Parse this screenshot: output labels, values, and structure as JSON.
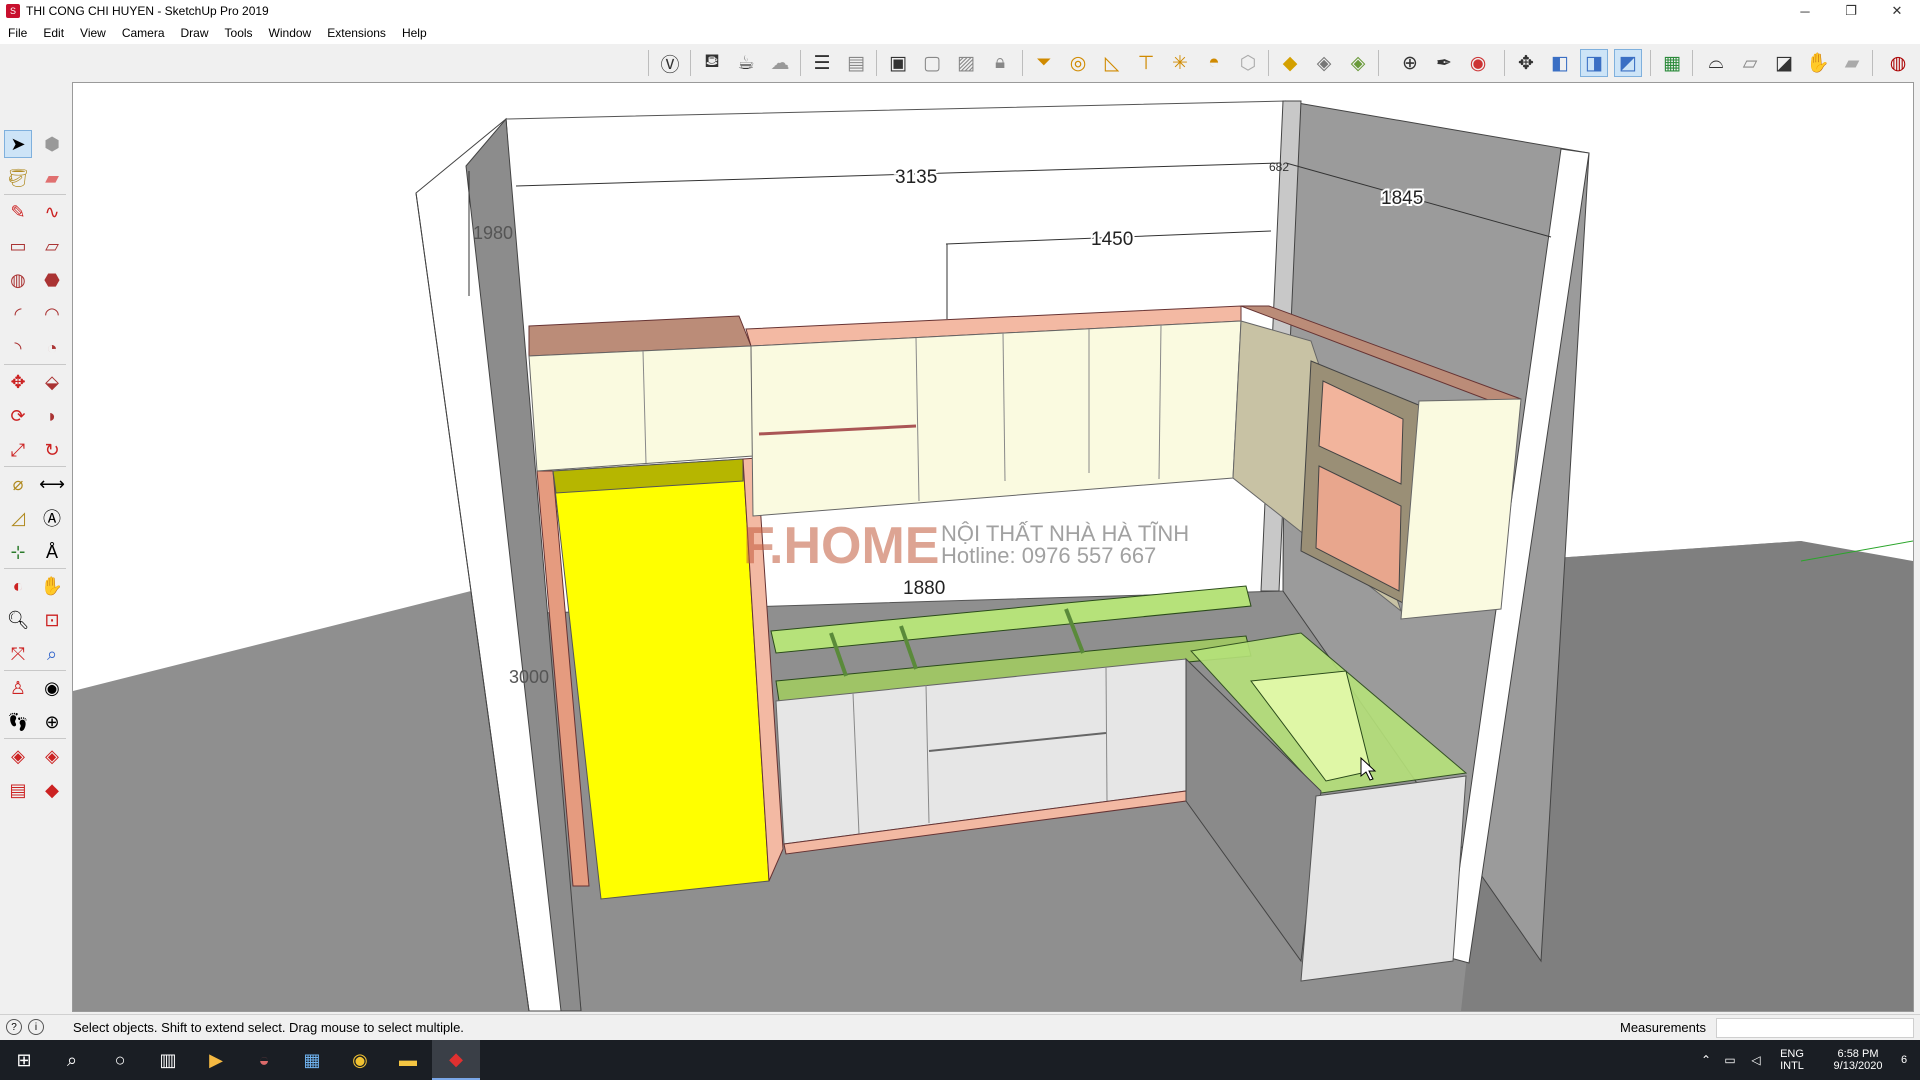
{
  "window": {
    "title": "THI CONG CHI HUYEN - SketchUp Pro 2019",
    "min": "─",
    "restore": "❐",
    "close": "✕"
  },
  "menu": [
    "File",
    "Edit",
    "View",
    "Camera",
    "Draw",
    "Tools",
    "Window",
    "Extensions",
    "Help"
  ],
  "toolbar_icons": [
    "circle-v-icon",
    "teapot-icon",
    "hand-cup-icon",
    "cloud-icon",
    "stack-icon",
    "panel-icon",
    "window-icon",
    "frame-icon",
    "image-icon",
    "lock-box-icon",
    "funnel-icon",
    "ring-icon",
    "ramp-icon",
    "tower-icon",
    "star-burst-icon",
    "dome-icon",
    "hexagon-icon",
    "cube-yellow-icon",
    "cube-gray-icon",
    "cube-green-icon",
    "globe-target-icon",
    "pen-tilt-icon",
    "globe-red-icon",
    "move-cross-icon",
    "box-blue-icon",
    "box-blue-2-icon",
    "box-blue-3-icon",
    "map-green-icon",
    "tray-icon",
    "cube-outline-icon",
    "cube-dark-icon",
    "hand-wave-icon",
    "tablet-icon",
    "ruby-globe-icon"
  ],
  "viewport": {
    "dimensions": {
      "d3135": "3135",
      "d1980": "1980",
      "d1845": "1845",
      "d1450": "1450",
      "d1880": "1880",
      "d3000": "3000",
      "d_corner": "682"
    },
    "watermark": {
      "logo": "F.HOME",
      "line1": "NỘI THẤT NHÀ HÀ TĨNH",
      "line2": "Hotline:  0976 557 667"
    },
    "colors": {
      "wall": "#ffffff",
      "wall_side": "#9b9b9b",
      "floor": "#8f8f8f",
      "cabinet_face": "#fafae0",
      "cabinet_edge": "#f3b9a3",
      "fridge": "#ffff00",
      "countertop": "#b6e27a",
      "lower_face": "#e6e6e6"
    }
  },
  "status": {
    "hint": "Select objects. Shift to extend select. Drag mouse to select multiple.",
    "measurements_label": "Measurements",
    "measurements_value": ""
  },
  "taskbar": {
    "lang1": "ENG",
    "lang2": "INTL",
    "time": "6:58 PM",
    "date": "9/13/2020",
    "notif": "6"
  }
}
